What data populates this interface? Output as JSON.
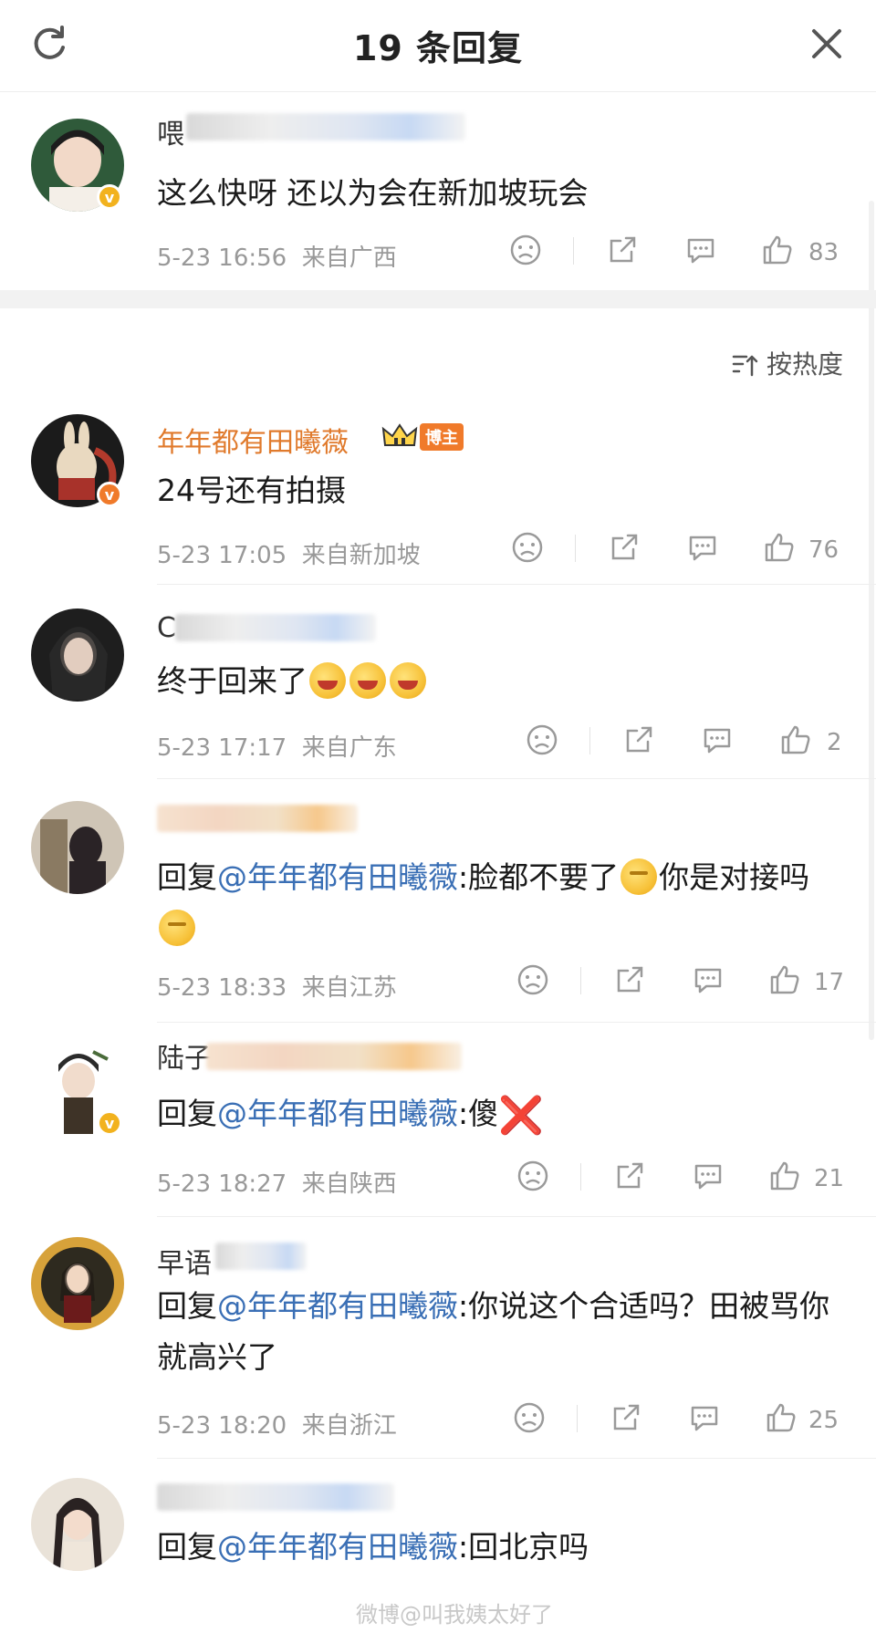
{
  "header": {
    "title": "19 条回复"
  },
  "top_comment": {
    "name_visible": "喂",
    "text": "这么快呀 还以为会在新加坡玩会",
    "timestamp": "5-23 16:56",
    "location": "来自广西",
    "likes": "83"
  },
  "sort": {
    "label": "按热度"
  },
  "comments": [
    {
      "name": "年年都有田曦薇",
      "tag": "博主",
      "text": "24号还有拍摄",
      "timestamp": "5-23 17:05",
      "location": "来自新加坡",
      "likes": "76"
    },
    {
      "name_visible": "C",
      "text": "终于回来了",
      "timestamp": "5-23 17:17",
      "location": "来自广东",
      "likes": "2"
    },
    {
      "reply_prefix": "回复",
      "mention": "@年年都有田曦薇",
      "text_a": ":脸都不要了",
      "text_b": "你是对接吗",
      "timestamp": "5-23 18:33",
      "location": "来自江苏",
      "likes": "17"
    },
    {
      "name_visible": "陆子",
      "reply_prefix": "回复",
      "mention": "@年年都有田曦薇",
      "text": ":傻",
      "emoji_cross": "❌",
      "timestamp": "5-23 18:27",
      "location": "来自陕西",
      "likes": "21"
    },
    {
      "name_visible": "早语",
      "reply_prefix": "回复",
      "mention": "@年年都有田曦薇",
      "text": ":你说这个合适吗？田被骂你就高兴了",
      "timestamp": "5-23 18:20",
      "location": "来自浙江",
      "likes": "25"
    },
    {
      "reply_prefix": "回复",
      "mention": "@年年都有田曦薇",
      "text": ":回北京吗"
    }
  ],
  "watermark": "微博@叫我姨太好了",
  "colors": {
    "accent_name": "#e07a2c",
    "mention": "#3a6fb5",
    "meta": "#999999"
  },
  "icons": [
    "refresh-icon",
    "close-icon",
    "sort-icon",
    "dislike-icon",
    "share-icon",
    "comment-icon",
    "like-icon"
  ]
}
